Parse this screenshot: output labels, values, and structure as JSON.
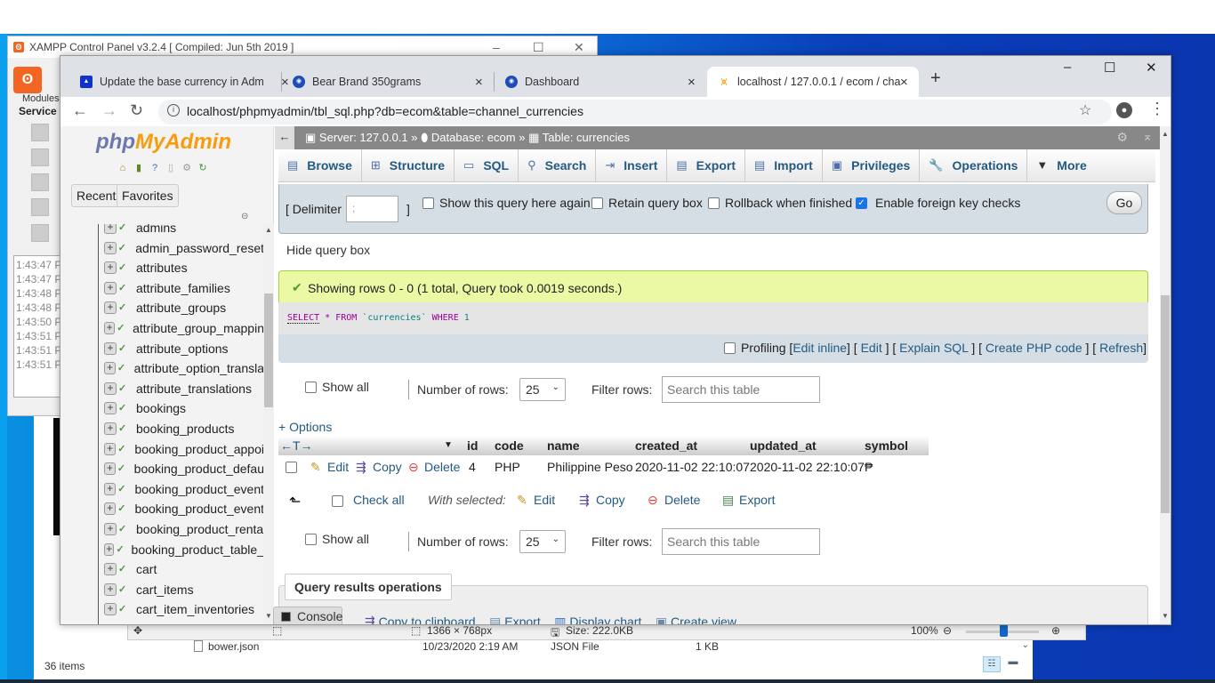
{
  "xampp": {
    "title": "XAMPP Control Panel v3.2.4   [ Compiled: Jun 5th 2019 ]",
    "modules_label": "Modules",
    "service_label": "Service",
    "log_lines": [
      "1:43:47 P",
      "1:43:47 P",
      "1:43:48 P",
      "1:43:48 P",
      "1:43:50 P",
      "1:43:51 P",
      "1:43:51 P",
      "1:43:51 P"
    ]
  },
  "explorer": {
    "file_name": "bower.json",
    "file_date": "10/23/2020 2:19 AM",
    "file_type": "JSON File",
    "file_size": "1 KB",
    "item_count": "36 items"
  },
  "viewer": {
    "dimensions": "1366 × 768px",
    "size": "Size: 222.0KB",
    "zoom": "100%",
    "zoom_fraction": 0.5
  },
  "browser": {
    "tabs": [
      {
        "title": "Update the base currency in Adm",
        "icon": "shopping-bag-icon",
        "active": false
      },
      {
        "title": "Bear Brand 350grams",
        "icon": "site-favicon",
        "active": false
      },
      {
        "title": "Dashboard",
        "icon": "site-favicon",
        "active": false
      },
      {
        "title": "localhost / 127.0.0.1 / ecom / cha",
        "icon": "phpmyadmin-favicon",
        "active": true
      }
    ],
    "url": "localhost/phpmyadmin/tbl_sql.php?db=ecom&table=channel_currencies"
  },
  "pma": {
    "logo_php": "php",
    "logo_myadmin": "MyAdmin",
    "recent_label": "Recent",
    "favorites_label": "Favorites",
    "tables": [
      "admins",
      "admin_password_reset",
      "attributes",
      "attribute_families",
      "attribute_groups",
      "attribute_group_mappin",
      "attribute_options",
      "attribute_option_transla",
      "attribute_translations",
      "bookings",
      "booking_products",
      "booking_product_appoi",
      "booking_product_defau",
      "booking_product_event",
      "booking_product_event",
      "booking_product_renta",
      "booking_product_table_",
      "cart",
      "cart_items",
      "cart_item_inventories"
    ],
    "breadcrumb": {
      "server": "Server: 127.0.0.1",
      "database": "Database: ecom",
      "table": "Table: currencies"
    },
    "menu": [
      "Browse",
      "Structure",
      "SQL",
      "Search",
      "Insert",
      "Export",
      "Import",
      "Privileges",
      "Operations",
      "More"
    ],
    "query_options": {
      "delimiter_label": "[ Delimiter",
      "delimiter_close": "]",
      "delimiter_value": ";",
      "show_query_again": "Show this query here again",
      "retain_query_box": "Retain query box",
      "rollback": "Rollback when finished",
      "foreign_key_checks": "Enable foreign key checks",
      "foreign_key_checked": true,
      "go": "Go"
    },
    "hide_query_box": "Hide query box",
    "success_message": "Showing rows 0 - 0 (1 total, Query took 0.0019 seconds.)",
    "sql": {
      "select": "SELECT",
      "star": "*",
      "from": "FROM",
      "table": "`currencies`",
      "where": "WHERE",
      "value": "1"
    },
    "sql_tools": {
      "profiling": "Profiling",
      "edit_inline": "Edit inline",
      "edit": "Edit",
      "explain": "Explain SQL",
      "create_php": "Create PHP code",
      "refresh": "Refresh"
    },
    "row_controls": {
      "show_all": "Show all",
      "number_of_rows_label": "Number of rows:",
      "number_of_rows_value": "25",
      "filter_label": "Filter rows:",
      "filter_placeholder": "Search this table"
    },
    "options_link": "+ Options",
    "columns": [
      "id",
      "code",
      "name",
      "created_at",
      "updated_at",
      "symbol"
    ],
    "rows": [
      {
        "id": "4",
        "code": "PHP",
        "name": "Philippine Peso",
        "created_at": "2020-11-02 22:10:07",
        "updated_at": "2020-11-02 22:10:07",
        "symbol": "₱"
      }
    ],
    "row_actions": {
      "edit": "Edit",
      "copy": "Copy",
      "delete": "Delete"
    },
    "with_selected": {
      "check_all": "Check all",
      "label": "With selected:",
      "edit": "Edit",
      "copy": "Copy",
      "delete": "Delete",
      "export": "Export"
    },
    "query_results_operations": "Query results operations",
    "ops": [
      "Copy to clipboard",
      "Export",
      "Display chart",
      "Create view"
    ],
    "console": "Console"
  }
}
